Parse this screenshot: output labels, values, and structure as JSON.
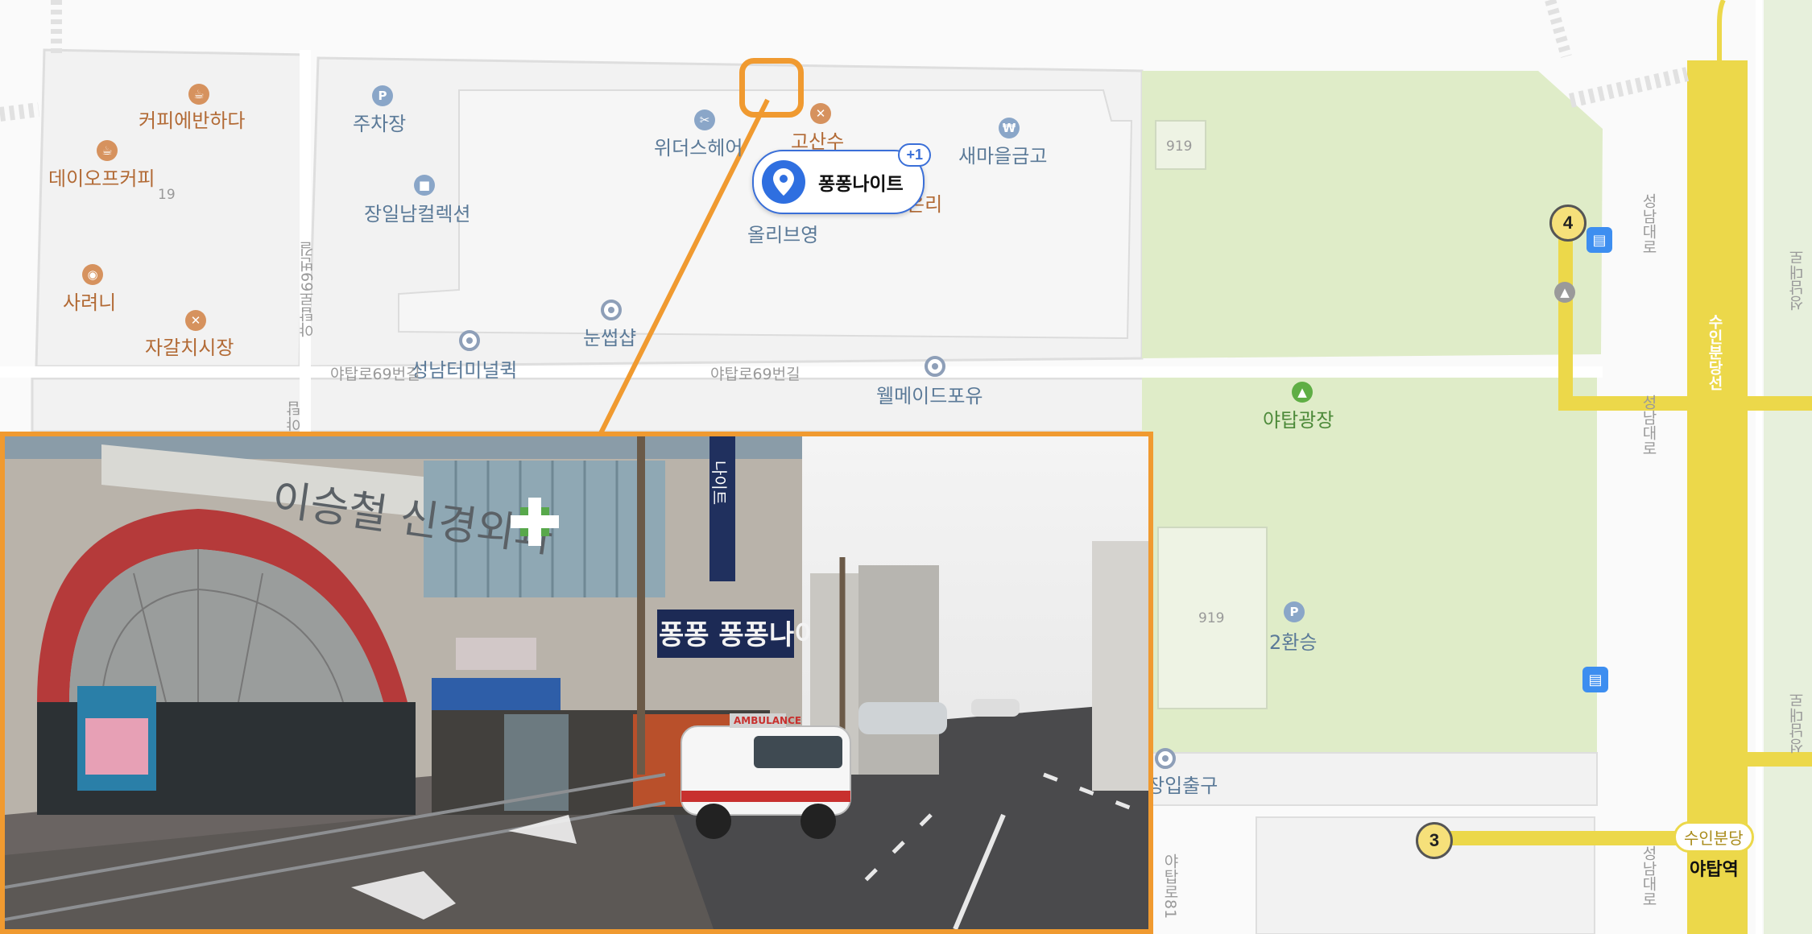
{
  "pois": {
    "cafe1": "커피에반하다",
    "cafe2": "데이오프커피",
    "block19": "19",
    "sarini": "사려니",
    "fish_market": "자갈치시장",
    "parking": "주차장",
    "jangil": "장일남컬렉션",
    "widers": "위더스헤어",
    "gosansu": "고산수",
    "samaeul": "새마을금고",
    "onri": "온리",
    "olive": "올리브영",
    "nunsseop": "눈썹샵",
    "terminal": "성남터미널퀵",
    "wellmade": "웰메이드포유",
    "park": "야탑광장",
    "block919a": "919",
    "block919b": "919",
    "transfer": "2환승",
    "entrance": "장입출구"
  },
  "streets": {
    "yatap69_vert": "야탑로69번길",
    "yatap69_a": "야탑로69번길",
    "yatap69_b": "야탑로69번길",
    "yatap_short": "야탑",
    "seongnam1": "성남대로",
    "seongnam2": "성남대로",
    "seongnam3": "성남대로",
    "bundang_line": "수인분당선",
    "right1": "성남대로",
    "right2": "성남대로",
    "bottom_vert": "야탑로81"
  },
  "selected_place": {
    "name": "퐁퐁나이트",
    "badge": "+1"
  },
  "transit": {
    "exit4": "4",
    "exit3": "3",
    "line_tag": "수인분당",
    "station": "야탑역"
  },
  "photo": {
    "signs": {
      "clinic": "이승철 신경외과",
      "night": "퐁퐁 퐁퐁나이트",
      "tower": "나이트",
      "ambulance": "AMBULANCE"
    }
  },
  "colors": {
    "accent": "#f09a30",
    "pin": "#2f6fe0",
    "subway_line": "#ecd84a",
    "park": "#dfecc8"
  }
}
